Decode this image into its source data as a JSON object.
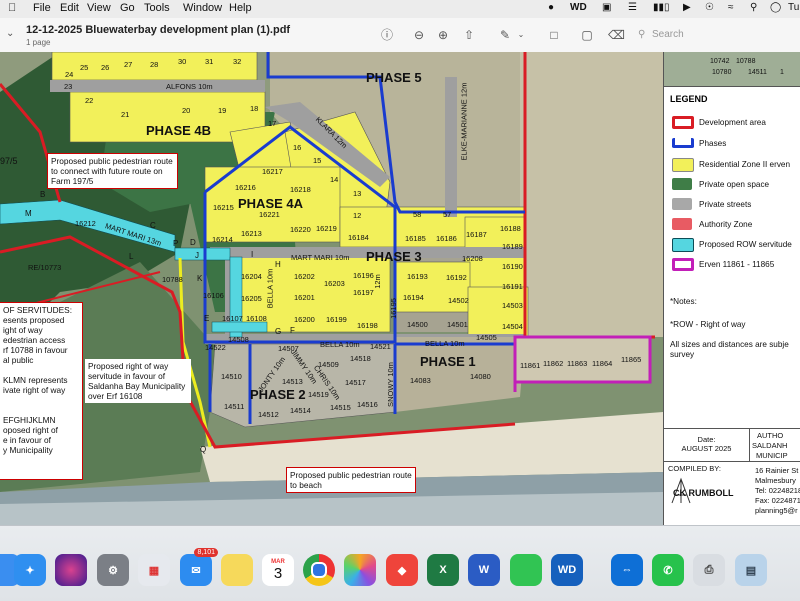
{
  "menubar": {
    "items": [
      "File",
      "Edit",
      "View",
      "Go",
      "Tools",
      "Window",
      "Help"
    ],
    "status_text": "Tu"
  },
  "window": {
    "title": "12-12-2025 Bluewaterbay development plan (1).pdf",
    "subtitle": "1 page",
    "search_placeholder": "Search"
  },
  "map": {
    "phases": [
      "PHASE 5",
      "PHASE 4B",
      "PHASE 4A",
      "PHASE 3",
      "PHASE 1",
      "PHASE 2"
    ],
    "streets": [
      "ALFONS 10m",
      "KLARA 12m",
      "ELKE-MARIANNE 12m",
      "MART MARI 13m",
      "MART MARI 10m",
      "BELLA 10m",
      "BELLA 10m",
      "JONTY 10m",
      "JIMMY 10m",
      "CHRIS 10m",
      "SNOWY 10m",
      "BELLA 10m",
      "12m"
    ],
    "farm_label": "97/5",
    "erven_labels": [
      "25",
      "26",
      "27",
      "28",
      "30",
      "31",
      "32",
      "24",
      "23",
      "22",
      "21",
      "20",
      "19",
      "18",
      "17",
      "16",
      "15",
      "14",
      "13",
      "12",
      "16216",
      "16217",
      "16218",
      "16215",
      "16221",
      "16213",
      "16214",
      "16220",
      "16219",
      "16184",
      "16185",
      "16186",
      "16187",
      "16188",
      "16189",
      "16190",
      "16191",
      "16192",
      "16193",
      "16194",
      "16195",
      "16196",
      "16197",
      "16198",
      "16199",
      "16200",
      "16201",
      "16202",
      "16203",
      "16204",
      "16205",
      "16107",
      "16108",
      "16106",
      "16208",
      "14502",
      "14503",
      "14504",
      "14500",
      "14501",
      "14505",
      "14508",
      "14507",
      "14509",
      "14518",
      "14519",
      "14513",
      "14512",
      "14511",
      "14510",
      "14514",
      "14515",
      "14516",
      "14517",
      "14522",
      "14521",
      "14083",
      "14080",
      "11861",
      "11862",
      "11863",
      "11864",
      "11865",
      "16212",
      "10788",
      "58",
      "57",
      "RE/10773"
    ],
    "point_letters": [
      "B",
      "C",
      "M",
      "D",
      "P",
      "L",
      "J",
      "K",
      "I",
      "H",
      "G",
      "F",
      "E",
      "Q"
    ],
    "note_left_top": "Proposed public pedestrian route to connect with future route on Farm 197/5",
    "note_mid": "Proposed right of way servitude in favour of Saldanha Bay Municipality over Erf 16108",
    "note_bottom": "Proposed public pedestrian route to beach",
    "note_left_lines": [
      "OF SERVITUDES:",
      "esents proposed",
      "ight of way",
      "edestrian access",
      "rf 10788 in favour",
      "al public",
      "",
      "KLMN represents",
      "ivate right of way",
      "",
      "",
      "EFGHIJKLMN",
      "oposed right of",
      "e in favour of",
      "y Municipality"
    ]
  },
  "legend": {
    "thumb_labels": [
      "10742",
      "10788",
      "10780",
      "14511",
      "1"
    ],
    "title": "LEGEND",
    "items": [
      {
        "label": "Development area",
        "color": "#d91c24",
        "style": "outline"
      },
      {
        "label": "Phases",
        "color": "#1a3ccf",
        "style": "bracket"
      },
      {
        "label": "Residential Zone II erven",
        "color": "#f2f05a",
        "style": "fill"
      },
      {
        "label": "Private open space",
        "color": "#3f7d47",
        "style": "fill"
      },
      {
        "label": "Private streets",
        "color": "#a8a8a8",
        "style": "fill"
      },
      {
        "label": "Authority Zone",
        "color": "#e85b63",
        "style": "fill"
      },
      {
        "label": "Proposed ROW servitude",
        "color": "#55d6e0",
        "style": "fill"
      },
      {
        "label": "Erven 11861 - 11865",
        "color": "#c21fb8",
        "style": "outline"
      }
    ],
    "notes_title": "*Notes:",
    "note_row": "*ROW - Right of way",
    "note_sizes": "All sizes and distances are subje survey",
    "date_label": "Date:",
    "date_value": "AUGUST 2025",
    "authority_lines": [
      "AUTHO",
      "SALDANH",
      "MUNICIP"
    ],
    "compiled_label": "COMPILED BY:",
    "company": "CK RUMBOLL",
    "address_lines": [
      "16 Rainier St",
      "Malmesbury",
      "Tel: 02248218",
      "Fax: 02248712",
      "planning5@r"
    ]
  },
  "dock": {
    "mail_badge": "8,101",
    "calendar_month": "MAR",
    "calendar_day": "3",
    "apps": [
      "Finder",
      "Safari",
      "Siri",
      "System Settings",
      "Launchpad",
      "Mail",
      "Notes",
      "Calendar",
      "Chrome",
      "Photos",
      "AnyDesk",
      "Excel",
      "Word",
      "Numbers",
      "WD Discovery",
      "TeamViewer",
      "WhatsApp",
      "Printer",
      "Preview"
    ]
  },
  "colors": {
    "development": "#d91c24",
    "phase": "#1a3ccf",
    "erf": "#f2f05a",
    "open_space": "#3f7d47",
    "street": "#a8a8a8",
    "row": "#55d6e0",
    "magenta": "#c21fb8"
  }
}
